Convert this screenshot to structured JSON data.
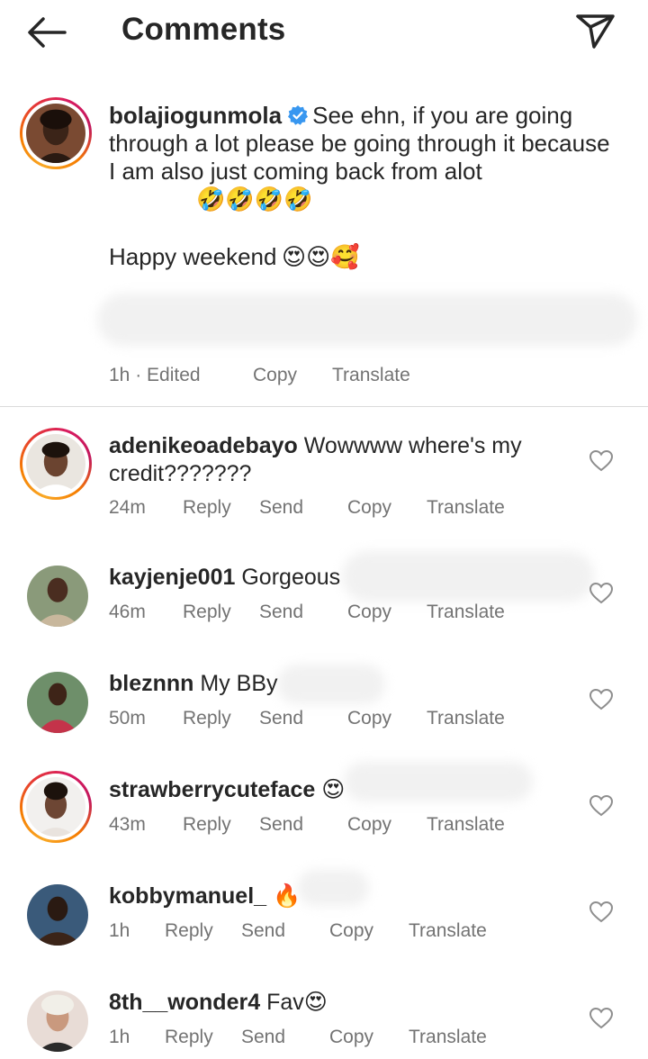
{
  "header": {
    "title": "Comments",
    "back_icon": "arrow-left-icon",
    "share_icon": "paper-plane-icon"
  },
  "caption": {
    "username": "bolajiogunmola",
    "text": "See ehn, if you are going through a lot please be going through it because I am also just coming back from alot",
    "emojis": "🤣🤣🤣🤣",
    "text2": "Happy weekend",
    "emojis2": "😍😍🥰",
    "time": "1h · Edited",
    "copy": "Copy",
    "translate": "Translate"
  },
  "comments": [
    {
      "username": "adenikeoadebayo",
      "text": "Wowwww where's my credit???????",
      "time": "24m",
      "reply": "Reply",
      "send": "Send",
      "copy": "Copy",
      "translate": "Translate"
    },
    {
      "username": "kayjenje001",
      "text": "Gorgeous",
      "time": "46m",
      "reply": "Reply",
      "send": "Send",
      "copy": "Copy",
      "translate": "Translate"
    },
    {
      "username": "bleznnn",
      "text": "My BBy",
      "time": "50m",
      "reply": "Reply",
      "send": "Send",
      "copy": "Copy",
      "translate": "Translate"
    },
    {
      "username": "strawberrycuteface",
      "text": "😍",
      "time": "43m",
      "reply": "Reply",
      "send": "Send",
      "copy": "Copy",
      "translate": "Translate"
    },
    {
      "username": "kobbymanuel_",
      "text": "🔥",
      "time": "1h",
      "reply": "Reply",
      "send": "Send",
      "copy": "Copy",
      "translate": "Translate"
    },
    {
      "username": "8th__wonder4",
      "text": "Fav😍",
      "time": "1h",
      "reply": "Reply",
      "send": "Send",
      "copy": "Copy",
      "translate": "Translate"
    }
  ],
  "colors": {
    "text": "#262626",
    "secondary": "#737373",
    "verified": "#3897f0",
    "divider": "#dbdbdb"
  }
}
